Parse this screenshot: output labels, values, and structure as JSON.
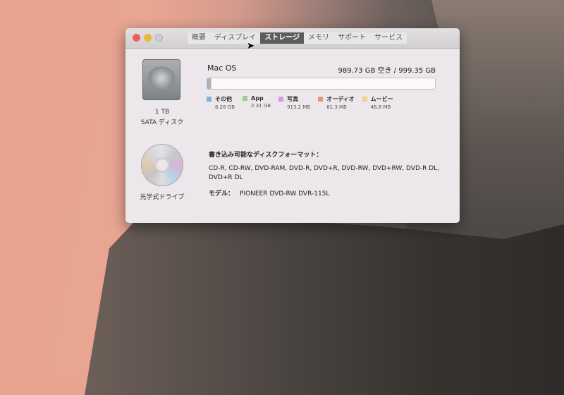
{
  "window": {
    "tabs": [
      {
        "label": "概要"
      },
      {
        "label": "ディスプレイ"
      },
      {
        "label": "ストレージ",
        "active": true
      },
      {
        "label": "メモリ"
      },
      {
        "label": "サポート"
      },
      {
        "label": "サービス"
      }
    ]
  },
  "disk": {
    "capacity": "1 TB",
    "type": "SATA ディスク",
    "volume": "Mac OS",
    "free": "989.73 GB 空き / 999.35 GB",
    "usage": [
      {
        "label": "その他",
        "size": "6.28 GB",
        "color": "#7fb3e0",
        "gb": 6.28
      },
      {
        "label": "App",
        "size": "2.31 GB",
        "color": "#9fcf94",
        "gb": 2.31
      },
      {
        "label": "写真",
        "size": "913.2 MB",
        "color": "#d79be0",
        "gb": 0.913
      },
      {
        "label": "オーディオ",
        "size": "61.3 MB",
        "color": "#e29a7e",
        "gb": 0.061
      },
      {
        "label": "ムービー",
        "size": "46.8 MB",
        "color": "#ead48e",
        "gb": 0.047
      }
    ],
    "total_gb": 999.35
  },
  "optical": {
    "label": "光学式ドライブ",
    "formats_heading": "書き込み可能なディスクフォーマット：",
    "formats": "CD-R, CD-RW, DVD-RAM, DVD-R, DVD+R, DVD-RW, DVD+RW, DVD-R DL, DVD+R DL",
    "model_label": "モデル：",
    "model": "PIONEER DVD-RW DVR-115L"
  }
}
